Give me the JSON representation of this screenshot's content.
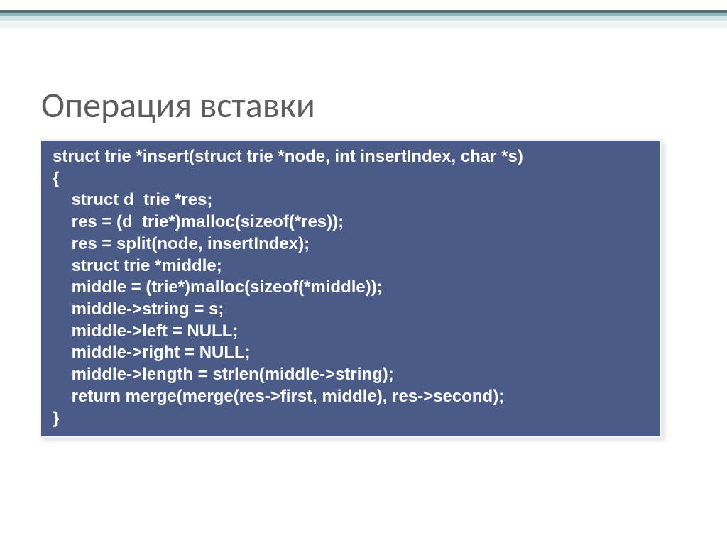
{
  "title": "Операция вставки",
  "code": {
    "lines": [
      "struct trie *insert(struct trie *node, int insertIndex, char *s)",
      "{",
      "    struct d_trie *res;",
      "    res = (d_trie*)malloc(sizeof(*res));",
      "    res = split(node, insertIndex);",
      "    struct trie *middle;",
      "    middle = (trie*)malloc(sizeof(*middle));",
      "    middle->string = s;",
      "    middle->left = NULL;",
      "    middle->right = NULL;",
      "    middle->length = strlen(middle->string);",
      "    return merge(merge(res->first, middle), res->second);",
      "}"
    ]
  }
}
